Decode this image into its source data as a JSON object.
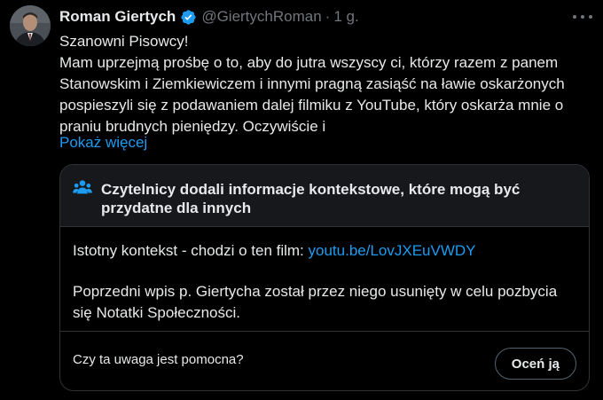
{
  "author": {
    "name": "Roman Giertych",
    "handle": "@GiertychRoman",
    "separator": "·",
    "time": "1 g.",
    "verified_color": "#1d9bf0"
  },
  "tweet": {
    "lines": [
      "Szanowni Pisowcy!",
      "Mam uprzejmą prośbę o to, aby do jutra wszyscy ci, którzy razem z panem",
      "Stanowskim i Ziemkiewiczem i innymi pragną zasiąść na ławie oskarżonych",
      "pospieszyli się z podawaniem dalej filmiku z YouTube, który oskarża mnie o",
      "praniu brudnych pieniędzy. Oczywiście i"
    ],
    "show_more": "Pokaż więcej"
  },
  "community_note": {
    "icon": "people-icon",
    "title": "Czytelnicy dodali informacje kontekstowe, które mogą być przydatne dla innych",
    "context_prefix": "Istotny kontekst - chodzi o ten film: ",
    "context_link": "youtu.be/LovJXEuVWDY",
    "paragraph2_lines": [
      "Poprzedni wpis p. Giertycha został przez niego usunięty w celu pozbycia",
      "się Notatki Społeczności."
    ],
    "question": "Czy ta uwaga jest pomocna?",
    "rate_label": "Oceń ją"
  },
  "colors": {
    "background": "#000000",
    "text": "#e7e9ea",
    "secondary": "#71767b",
    "link": "#1d9bf0",
    "border": "#2f3336",
    "card_header": "#16181c"
  }
}
